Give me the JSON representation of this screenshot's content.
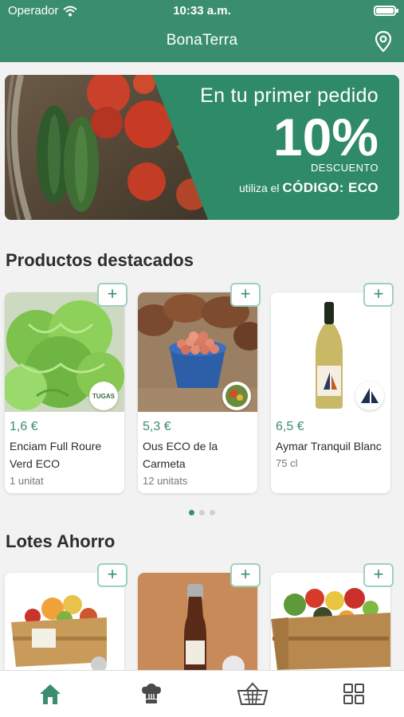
{
  "status_bar": {
    "carrier": "Operador",
    "time": "10:33 a.m."
  },
  "header": {
    "title": "BonaTerra",
    "location_icon": "location-pin-icon"
  },
  "banner": {
    "line1": "En tu primer pedido",
    "percent": "10%",
    "discount_label": "DESCUENTO",
    "use_label": "utiliza el",
    "code_label": "CÓDIGO: ECO"
  },
  "featured": {
    "title": "Productos destacados",
    "products": [
      {
        "price": "1,6 €",
        "name": "Enciam Full Roure Verd ECO",
        "unit": "1 unitat",
        "badge": "TUGAS"
      },
      {
        "price": "5,3 €",
        "name": "Ous ECO de la Carmeta",
        "unit": "12 unitats"
      },
      {
        "price": "6,5 €",
        "name": "Aymar Tranquil Blanc",
        "unit": "75 cl"
      }
    ],
    "add_label": "+"
  },
  "lots": {
    "title": "Lotes Ahorro"
  },
  "tabs": [
    "home-icon",
    "chef-hat-icon",
    "basket-icon",
    "grid-icon"
  ],
  "colors": {
    "brand": "#3a8e6e",
    "accent_border": "#9fd0bd"
  }
}
